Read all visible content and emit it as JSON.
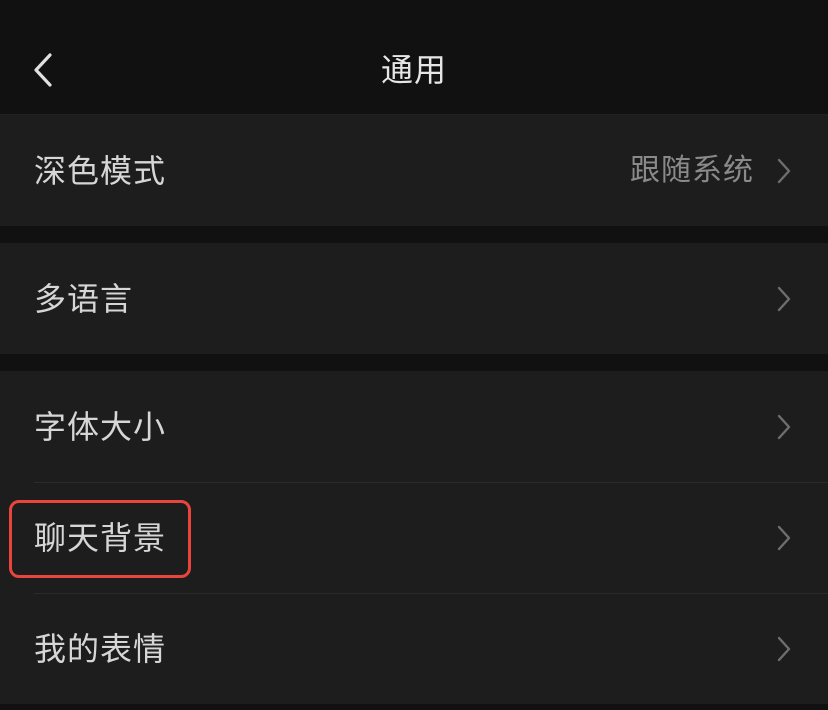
{
  "nav": {
    "title": "通用",
    "back_icon": "chevron-left-icon"
  },
  "groups": [
    {
      "items": [
        {
          "label": "深色模式",
          "value": "跟随系统",
          "icon": "chevron-right-icon"
        }
      ]
    },
    {
      "items": [
        {
          "label": "多语言",
          "value": "",
          "icon": "chevron-right-icon"
        }
      ]
    },
    {
      "items": [
        {
          "label": "字体大小",
          "value": "",
          "icon": "chevron-right-icon"
        },
        {
          "label": "聊天背景",
          "value": "",
          "icon": "chevron-right-icon",
          "highlighted": true
        },
        {
          "label": "我的表情",
          "value": "",
          "icon": "chevron-right-icon"
        }
      ]
    }
  ],
  "colors": {
    "background": "#111111",
    "cell": "#1d1d1d",
    "text": "#d6d6d6",
    "secondary_text": "#8a8a8a",
    "highlight": "#e8453c"
  }
}
